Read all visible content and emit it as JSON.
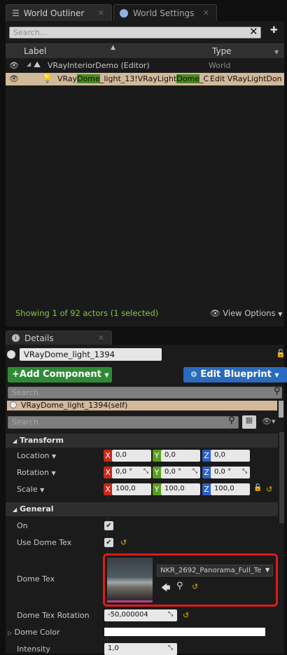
{
  "tabs": {
    "outliner": "World Outliner",
    "settings": "World Settings"
  },
  "outliner": {
    "search_placeholder": "Search...",
    "col_label": "Label",
    "col_type": "Type",
    "rows": [
      {
        "name": "VRayInteriorDemo (Editor)",
        "type": "World"
      },
      {
        "name_parts": [
          "VRay",
          "Dome",
          "_light_13!VRayLight",
          "Dome",
          "_C"
        ],
        "type": "Edit VRayLightDon"
      }
    ],
    "status": "Showing 1 of 92 actors (1 selected)",
    "view_options": "View Options"
  },
  "details": {
    "tab": "Details",
    "name": "VRayDome_light_1394",
    "add_component": "+Add Component",
    "edit_blueprint": "Edit Blueprint",
    "comp_search_placeholder": "Search",
    "component_self": "VRayDome_light_1394(self)",
    "prop_search_placeholder": "Search",
    "transform": {
      "title": "Transform",
      "location": {
        "label": "Location",
        "x": "0,0",
        "y": "0,0",
        "z": "0,0"
      },
      "rotation": {
        "label": "Rotation",
        "x": "0,0 °",
        "y": "0,0 °",
        "z": "0,0 °"
      },
      "scale": {
        "label": "Scale",
        "x": "100,0",
        "y": "100,0",
        "z": "100,0"
      }
    },
    "general": {
      "title": "General",
      "on_label": "On",
      "use_dome_tex_label": "Use Dome Tex",
      "dome_tex_label": "Dome Tex",
      "dome_tex_value": "NKR_2692_Panorama_Full_Te",
      "dome_tex_rotation_label": "Dome Tex Rotation",
      "dome_tex_rotation_value": "-50,000004",
      "dome_color_label": "Dome Color",
      "intensity_label": "Intensity",
      "intensity_value": "1,0"
    }
  },
  "colors": {
    "x_axis": "#c8281c",
    "y_axis": "#5a9e1f",
    "z_axis": "#2e5fc4",
    "highlight": "#4c8b23",
    "add_component": "#2f8a35",
    "edit_blueprint": "#2a6bbd",
    "selection": "#d2b999",
    "red_outline": "#e01a1a"
  }
}
